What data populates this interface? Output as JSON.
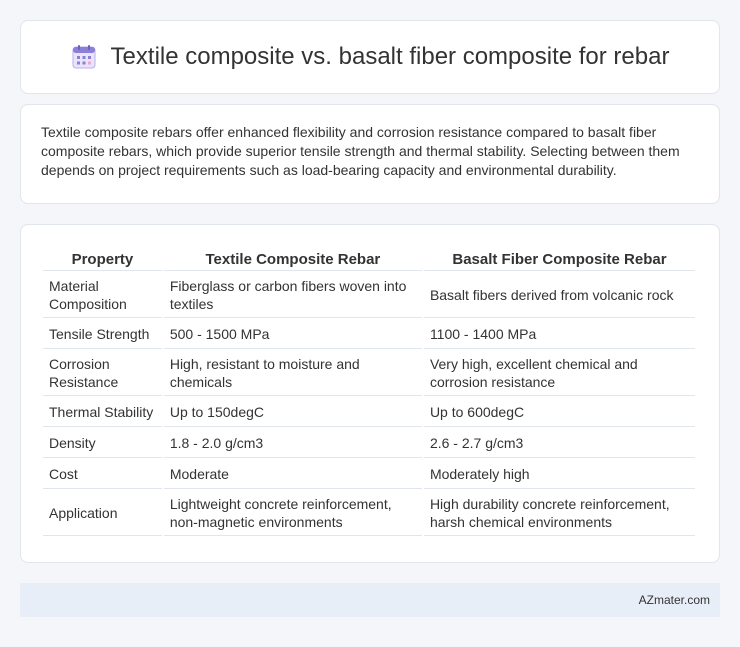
{
  "header": {
    "title": "Textile composite vs. basalt fiber composite for rebar",
    "icon": "calendar-grid-icon"
  },
  "summary": {
    "text": "Textile composite rebars offer enhanced flexibility and corrosion resistance compared to basalt fiber composite rebars, which provide superior tensile strength and thermal stability. Selecting between them depends on project requirements such as load-bearing capacity and environmental durability."
  },
  "table": {
    "headers": [
      "Property",
      "Textile Composite Rebar",
      "Basalt Fiber Composite Rebar"
    ],
    "rows": [
      [
        "Material Composition",
        "Fiberglass or carbon fibers woven into textiles",
        "Basalt fibers derived from volcanic rock"
      ],
      [
        "Tensile Strength",
        "500 - 1500 MPa",
        "1100 - 1400 MPa"
      ],
      [
        "Corrosion Resistance",
        "High, resistant to moisture and chemicals",
        "Very high, excellent chemical and corrosion resistance"
      ],
      [
        "Thermal Stability",
        "Up to 150degC",
        "Up to 600degC"
      ],
      [
        "Density",
        "1.8 - 2.0 g/cm3",
        "2.6 - 2.7 g/cm3"
      ],
      [
        "Cost",
        "Moderate",
        "Moderately high"
      ],
      [
        "Application",
        "Lightweight concrete reinforcement, non-magnetic environments",
        "High durability concrete reinforcement, harsh chemical environments"
      ]
    ]
  },
  "footer": {
    "brand": "AZmater.com"
  },
  "colors": {
    "accent": "#8b7fd6",
    "border": "#e1e5ec",
    "footer_bg": "#e8eef8"
  }
}
